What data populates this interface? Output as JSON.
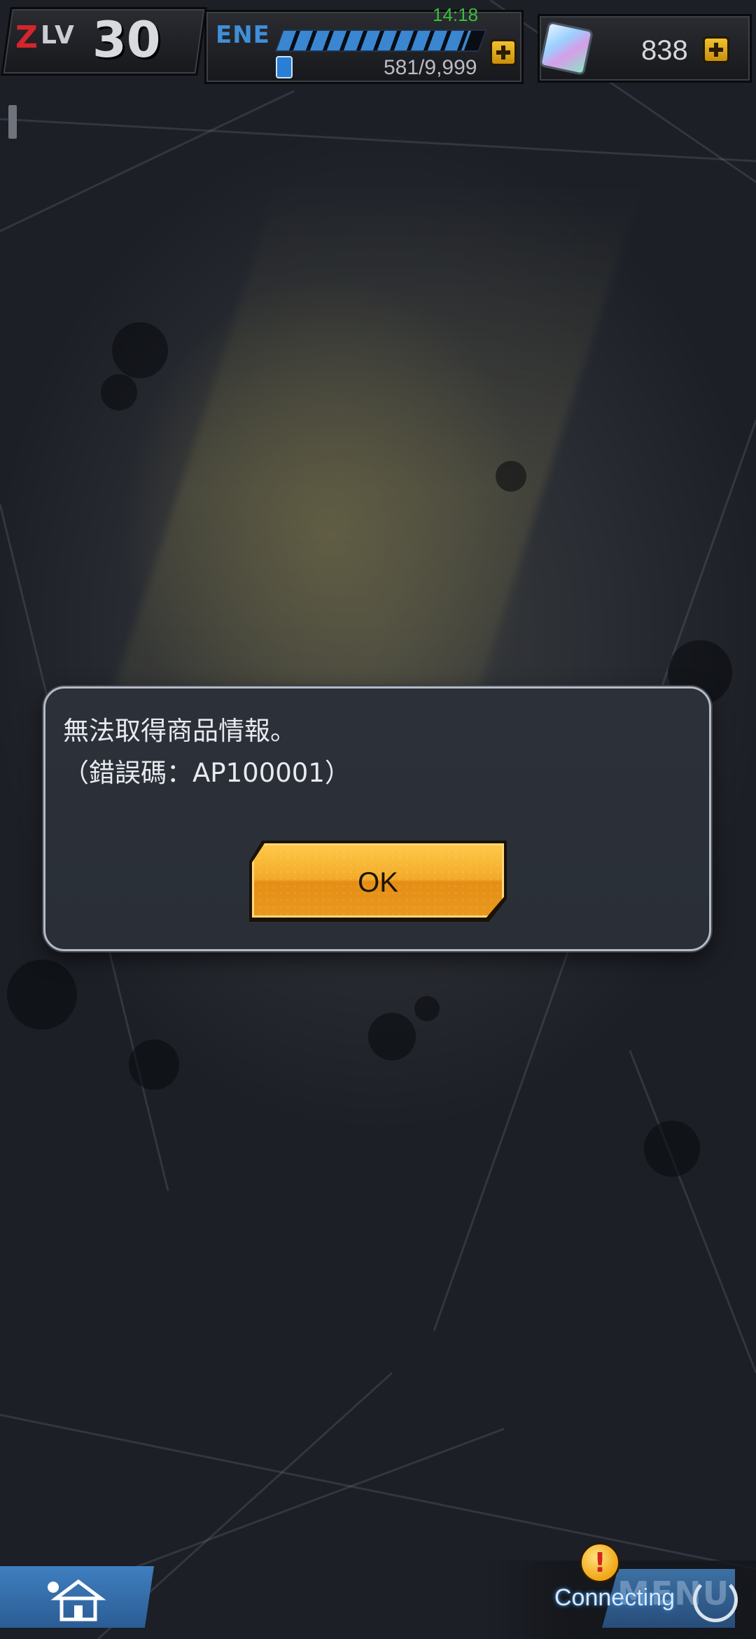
{
  "status_bar": {
    "clock": "14:18"
  },
  "hud": {
    "level": {
      "label": "LV",
      "value": "30"
    },
    "energy": {
      "label": "ENE",
      "value": "581/9,999",
      "fill_fraction": 0.93
    },
    "gems": {
      "value": "838"
    },
    "icons": [
      "energy-can-icon",
      "plus-icon",
      "gem-icon"
    ]
  },
  "dialog": {
    "message_line1": "無法取得商品情報。",
    "message_line2": "（錯誤碼：AP100001）",
    "ok_label": "OK"
  },
  "bottom_bar": {
    "connecting_text": "Connecting",
    "menu_label": "MENU",
    "alert_mark": "!",
    "icons": [
      "home-icon",
      "spinner-icon",
      "alert-icon"
    ]
  },
  "colors": {
    "ok_button": "#f3aa2a",
    "energy_bar": "#3a86d0",
    "level_z": "#d4262c",
    "clock": "#3bbf3b"
  }
}
